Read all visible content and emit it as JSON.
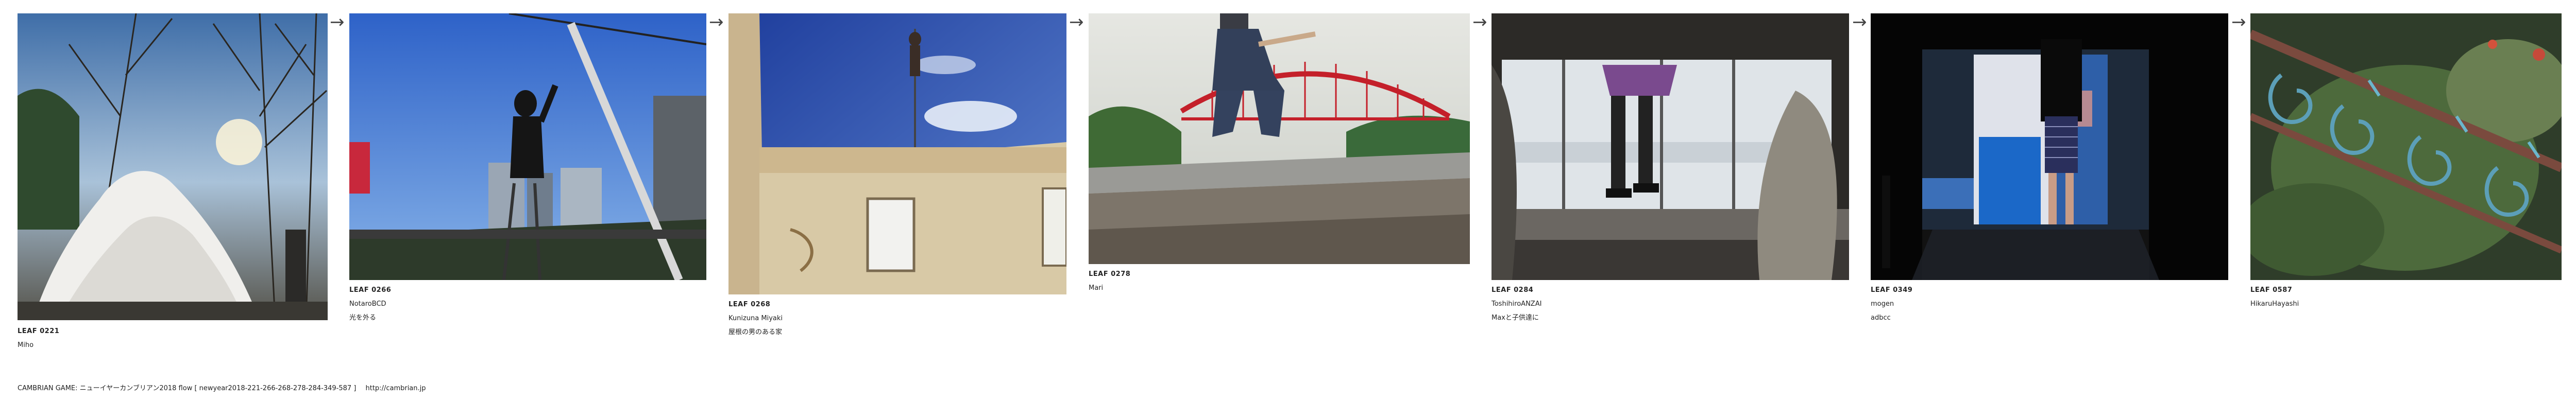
{
  "leaves": [
    {
      "id": "LEAF 0221",
      "lines": [
        "Miho"
      ],
      "scene": "white-tree-in-park"
    },
    {
      "id": "LEAF 0266",
      "lines": [
        "NotaroBCD",
        "光を外る"
      ],
      "scene": "figure-on-ladder-under-sky"
    },
    {
      "id": "LEAF 0268",
      "lines": [
        "Kunizuna Miyaki",
        "屋根の男のある家"
      ],
      "scene": "figure-on-pole-above-house"
    },
    {
      "id": "LEAF 0278",
      "lines": [
        "Mari"
      ],
      "scene": "person-jumping-before-red-bridge"
    },
    {
      "id": "LEAF 0284",
      "lines": [
        "ToshihiroANZAI",
        "Maxと子供達に"
      ],
      "scene": "legs-in-train-window"
    },
    {
      "id": "LEAF 0349",
      "lines": [
        "mogen",
        "adbcc"
      ],
      "scene": "person-before-projection"
    },
    {
      "id": "LEAF 0587",
      "lines": [
        "HikaruHayashi"
      ],
      "scene": "ironwork-railing-in-garden"
    }
  ],
  "arrow_glyph": "→",
  "footer": {
    "text": "CAMBRIAN GAME: ニューイヤーカンブリアン2018  flow [ newyear2018-221-266-268-278-284-349-587 ]",
    "link": "http://cambrian.jp"
  }
}
